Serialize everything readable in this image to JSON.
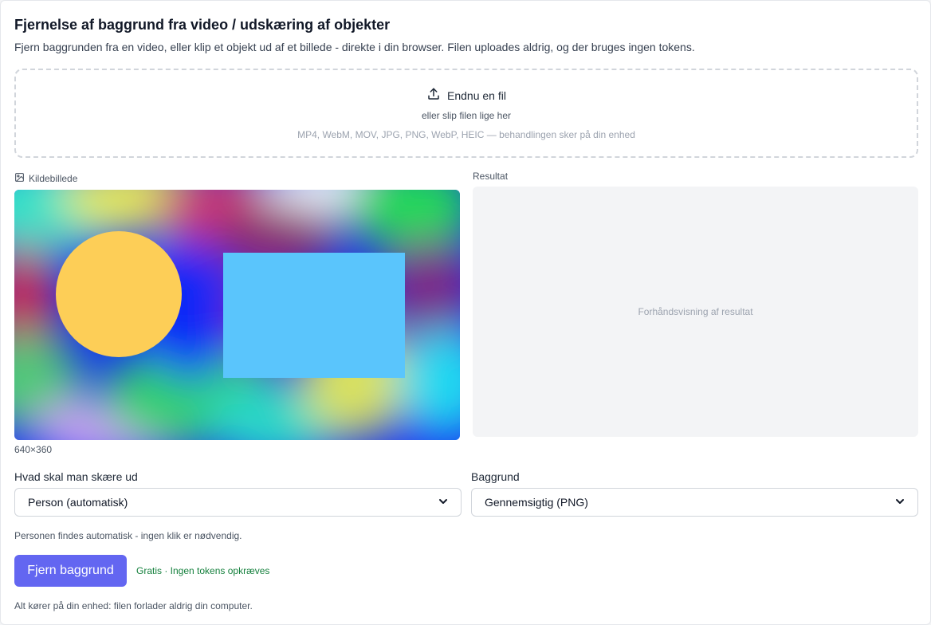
{
  "header": {
    "title": "Fjernelse af baggrund fra video / udskæring af objekter",
    "subtitle": "Fjern baggrunden fra en video, eller klip et objekt ud af et billede - direkte i din browser. Filen uploades aldrig, og der bruges ingen tokens."
  },
  "dropzone": {
    "button_label": "Endnu en fil",
    "button_icon": "upload-icon",
    "hint": "eller slip filen lige her",
    "formats": "MP4, WebM, MOV, JPG, PNG, WebP, HEIC — behandlingen sker på din enhed"
  },
  "source": {
    "label": "Kildebillede",
    "icon": "image-icon",
    "dimensions": "640×360"
  },
  "result": {
    "label": "Resultat",
    "placeholder": "Forhåndsvisning af resultat"
  },
  "cutout": {
    "label": "Hvad skal man skære ud",
    "selected": "Person (automatisk)"
  },
  "background": {
    "label": "Baggrund",
    "selected": "Gennemsigtig (PNG)"
  },
  "note": "Personen findes automatisk - ingen klik er nødvendig.",
  "action": {
    "button_label": "Fjern baggrund",
    "cost_text": "Gratis · Ingen tokens opkræves"
  },
  "footer": "Alt kører på din enhed: filen forlader aldrig din computer.",
  "colors": {
    "accent": "#6366f1",
    "free_text": "#15803d",
    "circle": "#fdce57",
    "rectangle": "#5ac5fc"
  }
}
